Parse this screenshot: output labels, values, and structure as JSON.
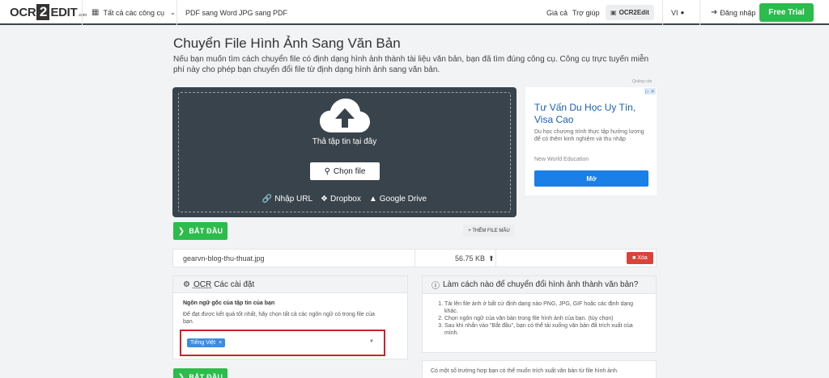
{
  "header": {
    "logo": {
      "part1": "OCR",
      "part2": "2",
      "part3": "EDIT",
      "tld": ".com"
    },
    "tools_menu": "Tất cả các công cụ",
    "links": [
      "PDF sang Word",
      "JPG sang PDF"
    ],
    "pricing": "Giá cả",
    "help": "Trợ giúp",
    "app_button": "OCR2Edit",
    "language": "VI",
    "login": "Đăng nhập",
    "free_trial": "Free Trial"
  },
  "main": {
    "title": "Chuyển File Hình Ảnh Sang Văn Bản",
    "description": "Nếu bạn muốn tìm cách chuyển file có định dạng hình ảnh thành tài liệu văn bản, bạn đã tìm đúng công cụ. Công cụ trực tuyến miễn phí này cho phép bạn chuyển đổi file từ định dạng hình ảnh sang văn bản."
  },
  "upload": {
    "drop_text": "Thả tập tin tại đây",
    "choose_file": "Chọn file",
    "sources": [
      "Nhập URL",
      "Dropbox",
      "Google Drive"
    ]
  },
  "ad": {
    "label": "Quảng cáo",
    "title": "Tư Vấn Du Học Uy Tín, Visa Cao",
    "body": "Du học chương trình thực tập hưởng lương để có thêm kinh nghiệm và thu nhập",
    "source": "New World Education",
    "cta": "Mở"
  },
  "actions": {
    "start": "BẮT ĐẦU",
    "add_sample": "+ THÊM FILE MẪU"
  },
  "file": {
    "name": "gearvn-blog-thu-thuat.jpg",
    "size": "56.75 KB",
    "delete": "Xóa"
  },
  "settings": {
    "header_abbr": "OCR",
    "header_rest": "Các cài đặt",
    "label": "Ngôn ngữ gốc của tập tin của bạn",
    "help": "Để đạt được kết quả tốt nhất, hãy chọn tất cả các ngôn ngữ có trong file của bạn.",
    "selected_language": "Tiếng Việt"
  },
  "howto": {
    "title": "Làm cách nào để chuyển đổi hình ảnh thành văn bản?",
    "steps": [
      "Tải lên file ảnh ở bất cứ định dạng nào PNG, JPG, GIF hoặc các định dạng khác.",
      "Chọn ngôn ngữ của văn bản trong file hình ảnh của bạn. (tùy chọn)",
      "Sau khi nhấn vào \"Bắt đầu\", bạn có thể tải xuống văn bản đã trích xuất của mình."
    ],
    "more": "Có một số trường hợp bạn có thể muốn trích xuất văn bản từ file hình ảnh."
  },
  "colors": {
    "accent_green": "#2bbc4b",
    "upload_bg": "#39434b",
    "danger": "#d9433a",
    "highlight_border": "#d0202a",
    "tag_blue": "#3b8de2"
  }
}
